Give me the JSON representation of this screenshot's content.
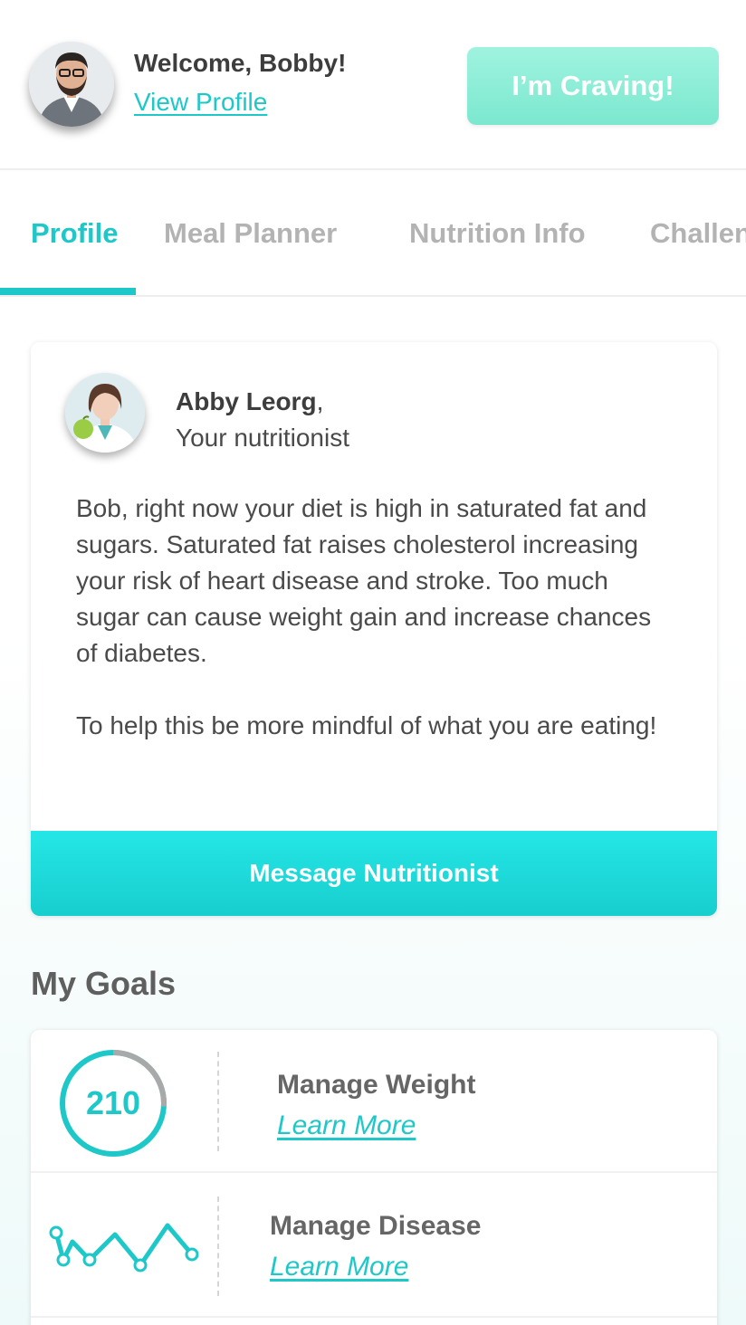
{
  "header": {
    "welcome": "Welcome, Bobby!",
    "view_profile": "View Profile",
    "craving_button": "I’m Craving!"
  },
  "tabs": [
    {
      "label": "Profile",
      "active": true
    },
    {
      "label": "Meal Planner",
      "active": false
    },
    {
      "label": "Nutrition Info",
      "active": false
    },
    {
      "label": "Challen",
      "active": false
    }
  ],
  "nutritionist": {
    "name": "Abby Leorg",
    "name_suffix": ",",
    "role": "Your nutritionist",
    "message_p1": "Bob, right now your diet is high in saturated fat and sugars. Saturated fat raises cholesterol increasing your risk of heart disease and stroke. Too much sugar can cause weight gain and increase chances of diabetes.",
    "message_p2": "To help this be more mindful of what you are eating!",
    "button": "Message Nutritionist"
  },
  "goals": {
    "title": "My Goals",
    "items": [
      {
        "title": "Manage Weight",
        "link": "Learn More",
        "value": "210",
        "progress": 0.26
      },
      {
        "title": "Manage Disease",
        "link": "Learn More"
      }
    ]
  },
  "colors": {
    "accent": "#1fc8c8",
    "craving": "#86ecd4",
    "text_dark": "#3d3d3d",
    "text_muted": "#b3b3b3"
  }
}
